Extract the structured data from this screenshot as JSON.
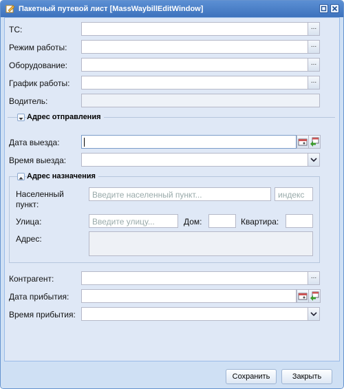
{
  "window": {
    "title": "Пакетный путевой лист [MassWaybillEditWindow]"
  },
  "fields": {
    "ts_label": "ТС:",
    "mode_label": "Режим работы:",
    "equipment_label": "Оборудование:",
    "schedule_label": "График работы:",
    "driver_label": "Водитель:",
    "departure_date_label": "Дата выезда:",
    "departure_time_label": "Время выезда:",
    "contractor_label": "Контрагент:",
    "arrival_date_label": "Дата прибытия:",
    "arrival_time_label": "Время прибытия:",
    "ellipsis": "..."
  },
  "departure_section": {
    "legend": "Адрес отправления"
  },
  "destination_section": {
    "legend": "Адрес назначения",
    "locality_label_1": "Населенный",
    "locality_label_2": "пункт:",
    "locality_placeholder": "Введите населенный пункт...",
    "postal_placeholder": "индекс",
    "street_label": "Улица:",
    "street_placeholder": "Введите улицу...",
    "house_label": "Дом:",
    "apartment_label": "Квартира:",
    "address_label": "Адрес:"
  },
  "buttons": {
    "save": "Сохранить",
    "close": "Закрыть"
  }
}
